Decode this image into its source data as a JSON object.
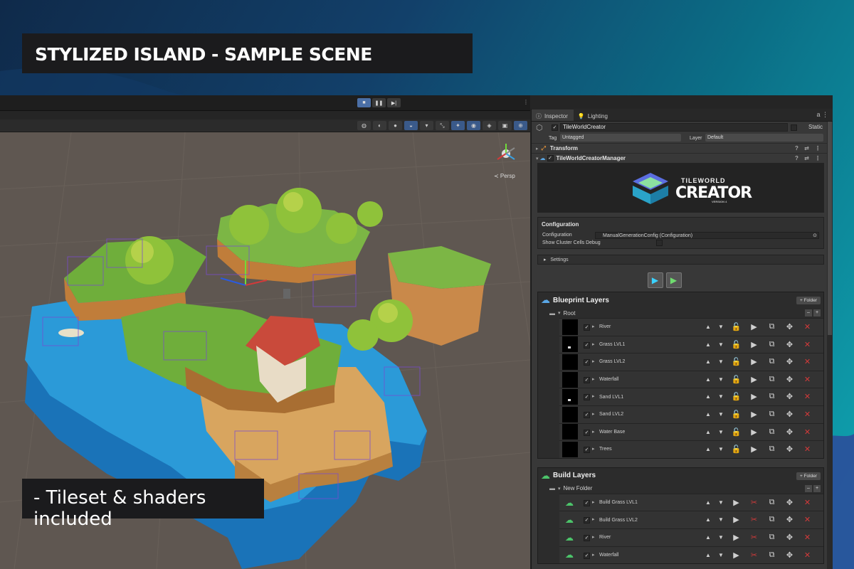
{
  "promo": {
    "title": "STYLIZED ISLAND - SAMPLE SCENE",
    "caption": "- Tileset & shaders included"
  },
  "scene": {
    "persp_label": "≺ Persp"
  },
  "inspector": {
    "tabs": [
      {
        "label": "Inspector",
        "icon": "info-icon"
      },
      {
        "label": "Lighting",
        "icon": "lightbulb-icon"
      }
    ],
    "object_name": "TileWorldCreator",
    "static_label": "Static",
    "tag_label": "Tag",
    "tag_value": "Untagged",
    "layer_label": "Layer",
    "layer_value": "Default",
    "components": [
      "Transform",
      "TileWorldCreatorManager"
    ],
    "logo": {
      "line1": "TILEWORLD",
      "line2": "CREATOR",
      "line3": "VERSION 4"
    },
    "configuration": {
      "title": "Configuration",
      "config_label": "Configuration",
      "config_value": "ManualGenerationConfig (Configuration)",
      "debug_label": "Show Cluster Cells Debug"
    },
    "settings_label": "Settings",
    "blueprint": {
      "title": "Blueprint Layers",
      "folder_button": "+ Folder",
      "root_label": "Root",
      "layers": [
        {
          "name": "River",
          "dot": false
        },
        {
          "name": "Grass LVL1",
          "dot": true
        },
        {
          "name": "Grass LVL2",
          "dot": false
        },
        {
          "name": "Waterfall",
          "dot": false
        },
        {
          "name": "Sand LVL1",
          "dot": true
        },
        {
          "name": "Sand LVL2",
          "dot": false
        },
        {
          "name": "Water Base",
          "dot": false
        },
        {
          "name": "Trees",
          "dot": false
        }
      ]
    },
    "build": {
      "title": "Build Layers",
      "folder_button": "+ Folder",
      "folder_label": "New Folder",
      "layers": [
        {
          "name": "Build Grass LVL1"
        },
        {
          "name": "Build Grass LVL2"
        },
        {
          "name": "River"
        },
        {
          "name": "Waterfall"
        }
      ]
    }
  },
  "colors": {
    "accent": "#4b6fa6",
    "delete_red": "#d23a3a",
    "panel_bg": "#383838"
  }
}
